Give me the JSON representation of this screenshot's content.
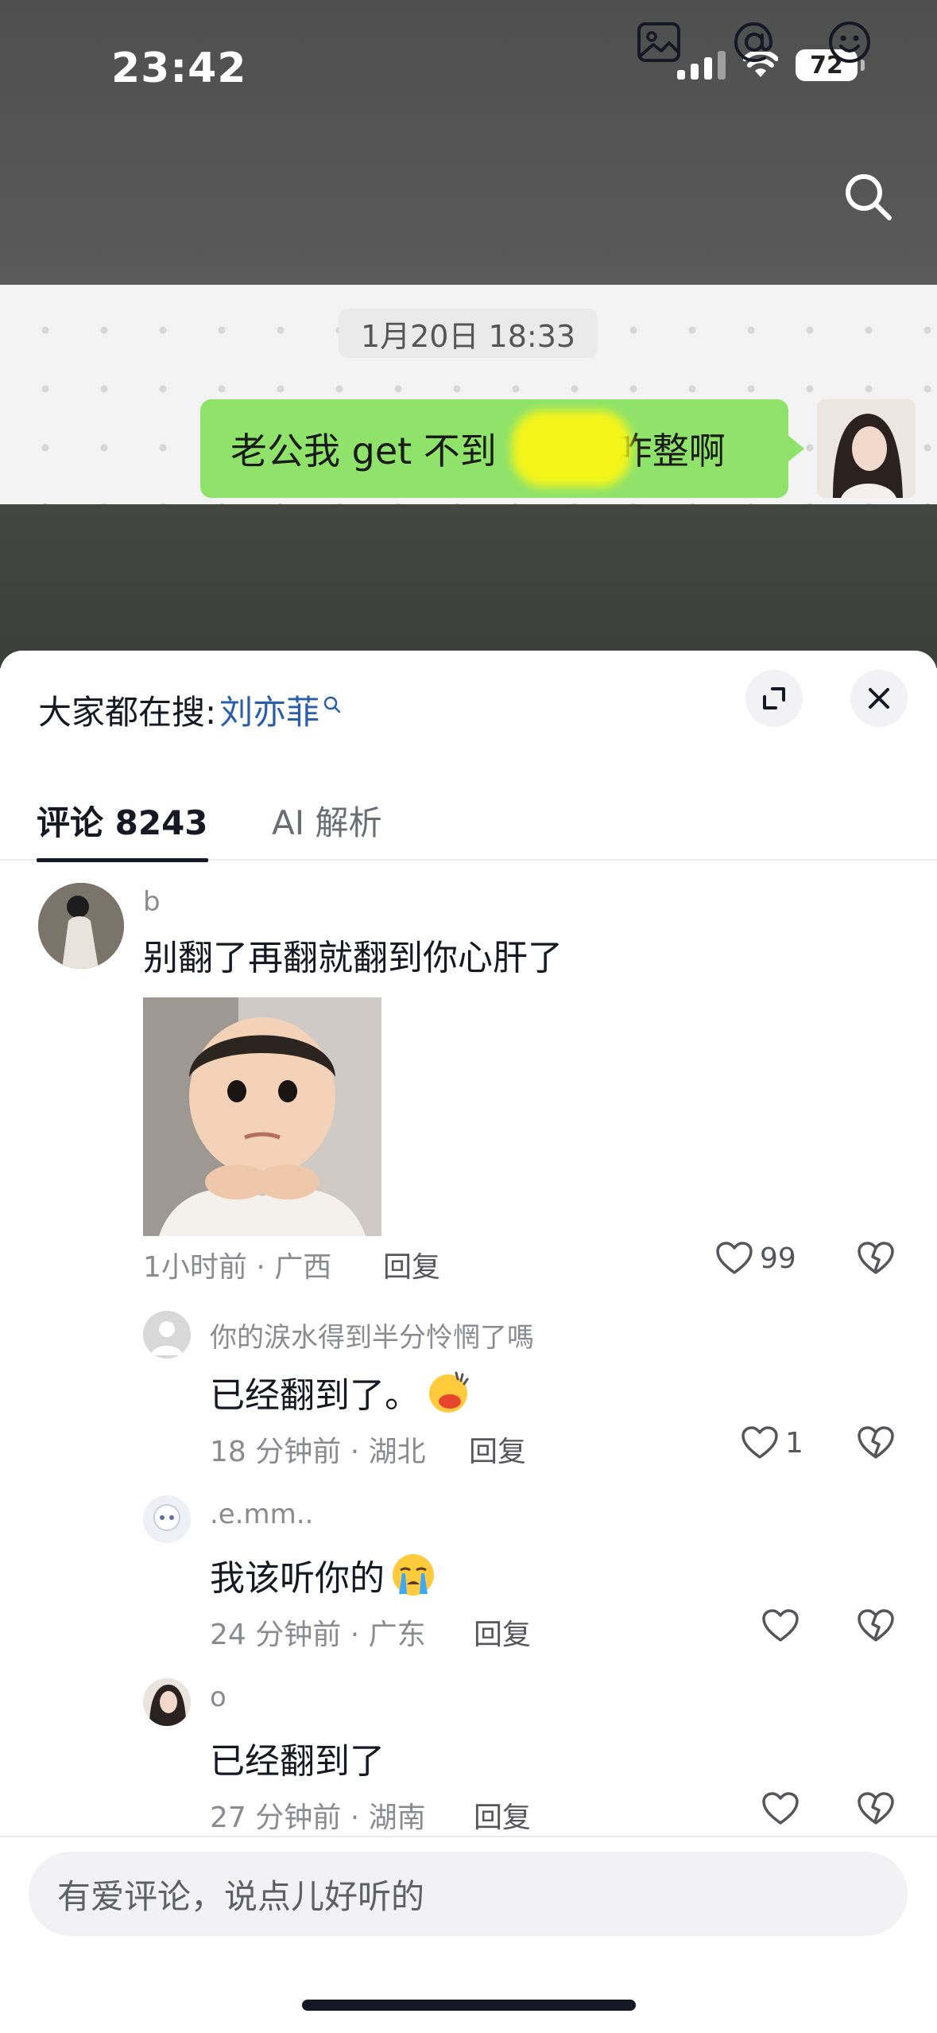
{
  "status_bar": {
    "time": "23:42",
    "battery": "72"
  },
  "video": {
    "chat_time": "1月20日 18:33",
    "bubble_text_before": "老公我 get 不到",
    "bubble_text_after": "咋整啊"
  },
  "sheet": {
    "hot_search_label": "大家都在搜:",
    "hot_search_keyword": "刘亦菲",
    "tabs": [
      {
        "label": "评论 8243"
      },
      {
        "label": "AI 解析"
      }
    ]
  },
  "comments": {
    "main": {
      "user": "b",
      "text": "别翻了再翻就翻到你心肝了",
      "meta": "1小时前 · 广西",
      "reply": "回复",
      "likes": "99"
    },
    "replies": [
      {
        "user": "你的涙水得到半分怜惘了嗎",
        "text": "已经翻到了。",
        "meta": "18 分钟前 · 湖北",
        "reply": "回复",
        "likes": "1"
      },
      {
        "user": ".e.mm..",
        "text": "我该听你的",
        "meta": "24 分钟前 · 广东",
        "reply": "回复",
        "likes": ""
      },
      {
        "user": "o",
        "text": "已经翻到了",
        "meta": "27 分钟前 · 湖南",
        "reply": "回复",
        "likes": ""
      }
    ]
  },
  "input": {
    "placeholder": "有爱评论，说点儿好听的"
  }
}
